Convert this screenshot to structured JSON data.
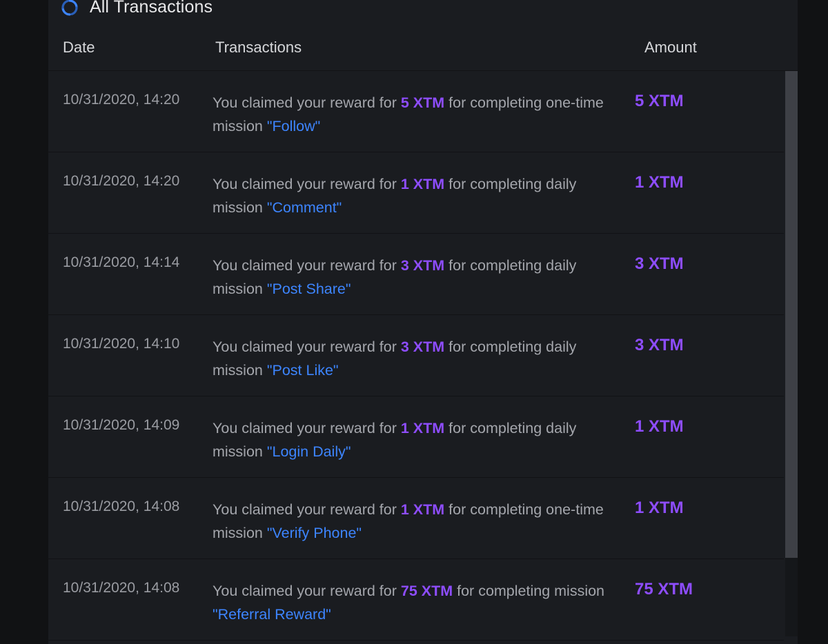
{
  "header": {
    "title": "All Transactions",
    "icon": "sync-icon",
    "accent": "#3d85ff"
  },
  "columns": {
    "date": "Date",
    "transactions": "Transactions",
    "amount": "Amount"
  },
  "colors": {
    "xtm": "#8e4dff",
    "mission_link": "#3d85ff"
  },
  "transactions": [
    {
      "date": "10/31/2020, 14:20",
      "prefix": "You claimed your reward for ",
      "xtm": "5 XTM",
      "middle": " for completing one-time mission ",
      "mission": "\"Follow\"",
      "amount": "5 XTM"
    },
    {
      "date": "10/31/2020, 14:20",
      "prefix": "You claimed your reward for ",
      "xtm": "1 XTM",
      "middle": " for completing daily mission ",
      "mission": "\"Comment\"",
      "amount": "1 XTM"
    },
    {
      "date": "10/31/2020, 14:14",
      "prefix": "You claimed your reward for ",
      "xtm": "3 XTM",
      "middle": " for completing daily mission ",
      "mission": "\"Post Share\"",
      "amount": "3 XTM"
    },
    {
      "date": "10/31/2020, 14:10",
      "prefix": "You claimed your reward for ",
      "xtm": "3 XTM",
      "middle": " for completing daily mission ",
      "mission": "\"Post Like\"",
      "amount": "3 XTM"
    },
    {
      "date": "10/31/2020, 14:09",
      "prefix": "You claimed your reward for ",
      "xtm": "1 XTM",
      "middle": " for completing daily mission ",
      "mission": "\"Login Daily\"",
      "amount": "1 XTM"
    },
    {
      "date": "10/31/2020, 14:08",
      "prefix": "You claimed your reward for ",
      "xtm": "1 XTM",
      "middle": " for completing one-time mission ",
      "mission": "\"Verify Phone\"",
      "amount": "1 XTM"
    },
    {
      "date": "10/31/2020, 14:08",
      "prefix": "You claimed your reward for ",
      "xtm": "75 XTM",
      "middle": " for completing mission ",
      "mission": "\"Referral Reward\"",
      "amount": "75 XTM"
    }
  ]
}
